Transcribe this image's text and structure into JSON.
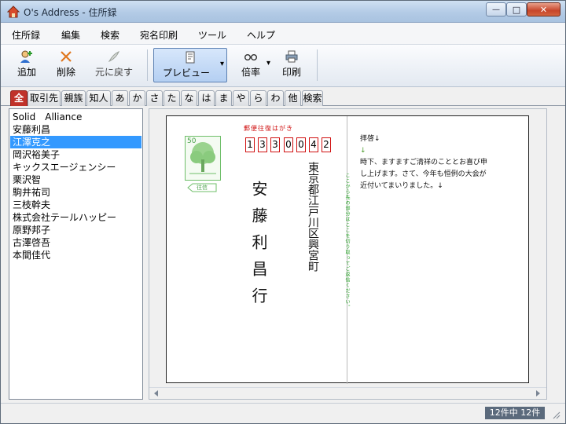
{
  "window": {
    "title": "O's Address - 住所録",
    "minimize_glyph": "—",
    "maximize_glyph": "□",
    "close_glyph": "✕"
  },
  "menu": [
    "住所録",
    "編集",
    "検索",
    "宛名印刷",
    "ツール",
    "ヘルプ"
  ],
  "toolbar": {
    "add": "追加",
    "delete": "削除",
    "undo": "元に戻す",
    "preview": "プレビュー",
    "zoom": "倍率",
    "print": "印刷",
    "dropdown_glyph": "▾"
  },
  "tabs": [
    "全",
    "取引先",
    "親族",
    "知人",
    "あ",
    "か",
    "さ",
    "た",
    "な",
    "は",
    "ま",
    "や",
    "ら",
    "わ",
    "他",
    "検索"
  ],
  "active_tab": 0,
  "contacts": [
    "Solid　Alliance",
    "安藤利昌",
    "江澤克之",
    "岡沢裕美子",
    "キックスエージェンシー",
    "栗沢智",
    "駒井祐司",
    "三枝幹夫",
    "株式会社テールハッピー",
    "原野邦子",
    "古澤啓吾",
    "本間佳代"
  ],
  "selected_contact": 2,
  "postcard": {
    "header": "郵便往復はがき",
    "stamp_value": "50",
    "stamp_label": "往信",
    "zip": [
      "1",
      "3",
      "3",
      "0",
      "0",
      "4",
      "2"
    ],
    "recipient_name": "安藤利昌行",
    "recipient_address": "東京都江戸川区興宮町",
    "vertical_note": "ここから先の部分はここを切り取ってご返信ください。",
    "message_lines": [
      "拝啓↓",
      "↓",
      "時下、ますますご清祥のこととお喜び申",
      "し上げます。さて、今年も恒例の大会が",
      "近付いてまいりました。↓"
    ]
  },
  "status": {
    "count": "12件中 12件"
  },
  "colors": {
    "accent_selection": "#3399ff",
    "active_tab": "#c0322a",
    "postcard_red": "#d01010",
    "note_green": "#28a428"
  }
}
